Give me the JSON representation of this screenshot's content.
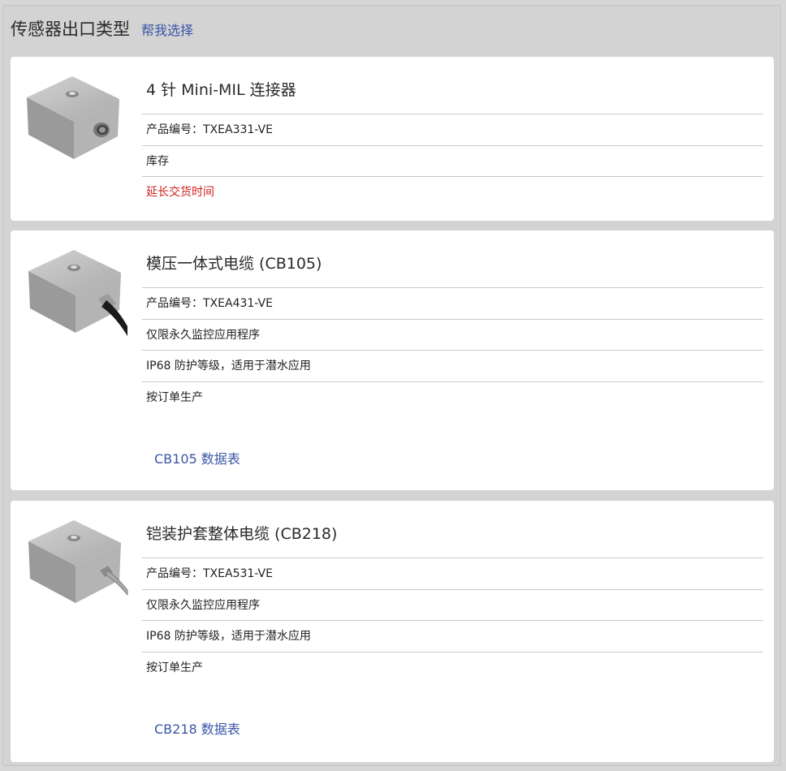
{
  "header": {
    "title": "传感器出口类型",
    "help_link": "帮我选择"
  },
  "cards": [
    {
      "title": "4 针 Mini-MIL 连接器",
      "rows": [
        "产品编号：TXEA331-VE",
        "库存",
        "延长交货时间"
      ],
      "image_icon": "sensor-connector-icon"
    },
    {
      "title": "模压一体式电缆 (CB105)",
      "rows": [
        "产品编号：TXEA431-VE",
        "仅限永久监控应用程序",
        "IP68 防护等级，适用于潜水应用",
        "按订单生产"
      ],
      "datasheet": "CB105 数据表",
      "image_icon": "sensor-molded-cable-icon"
    },
    {
      "title": "铠装护套整体电缆 (CB218)",
      "rows": [
        "产品编号：TXEA531-VE",
        "仅限永久监控应用程序",
        "IP68 防护等级，适用于潜水应用",
        "按订单生产"
      ],
      "datasheet": "CB218 数据表",
      "image_icon": "sensor-armored-cable-icon"
    }
  ],
  "colors": {
    "link": "#3a55a6",
    "warning": "#d0201c",
    "background": "#d3d3d3"
  }
}
